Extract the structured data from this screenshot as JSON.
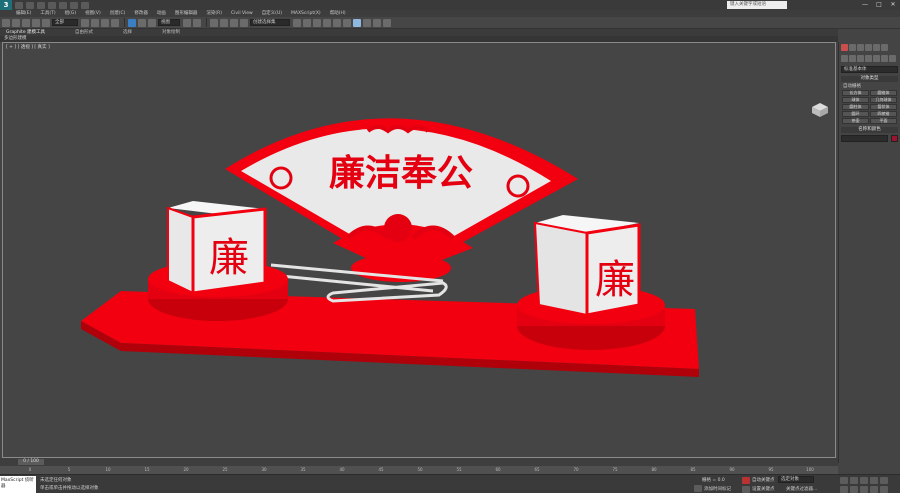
{
  "window": {
    "app_logo": "3",
    "search_placeholder": "键入关键字或短语",
    "controls": {
      "minimize": "—",
      "maximize": "□",
      "close": "✕"
    }
  },
  "menubar": {
    "items": [
      "编辑(E)",
      "工具(T)",
      "组(G)",
      "视图(V)",
      "创建(C)",
      "修改器",
      "动画",
      "图形编辑器",
      "渲染(R)",
      "Civil View",
      "自定义(U)",
      "MAXScript(X)",
      "帮助(H)"
    ]
  },
  "toolbar": {
    "selection_filter": "全部",
    "ref_coord": "视图",
    "named_selection": "创建选择集"
  },
  "ribbon": {
    "tabs": [
      "Graphite 建模工具",
      "自由形式",
      "选择",
      "对象绘制"
    ],
    "active_tab": 0,
    "subpanel": "多边形建模"
  },
  "viewport": {
    "label": "[ + ] [ 透视 ] [ 真实 ]"
  },
  "scene": {
    "fan_text": "廉洁奉公",
    "cube_character": "廉",
    "colors": {
      "red": "#f2000f",
      "white": "#e8e8e8",
      "dark_red": "#8b0000"
    }
  },
  "command_panel": {
    "category_dropdown": "标准基本体",
    "object_type_header": "对象类型",
    "auto_grid": "自动栅格",
    "objects": [
      "长方体",
      "圆锥体",
      "球体",
      "几何球体",
      "圆柱体",
      "管状体",
      "圆环",
      "四棱锥",
      "茶壶",
      "平面"
    ],
    "name_color_header": "名称和颜色",
    "object_color": "#9a1432"
  },
  "timeline": {
    "slider": "0 / 100",
    "ticks": [
      "0",
      "5",
      "10",
      "15",
      "20",
      "25",
      "30",
      "35",
      "40",
      "45",
      "50",
      "55",
      "60",
      "65",
      "70",
      "75",
      "80",
      "85",
      "90",
      "95",
      "100"
    ]
  },
  "status": {
    "script": "MaxScript 侦听器",
    "line1": "未选定任何对象",
    "line2": "单击或单击并拖动以选择对象",
    "grid_label": "栅格 = 0.0",
    "add_time_tag": "添加时间标记",
    "auto_key": "自动关键点",
    "selected_combo": "选定对象",
    "set_key": "设置关键点",
    "key_filters": "关键点过滤器..."
  }
}
